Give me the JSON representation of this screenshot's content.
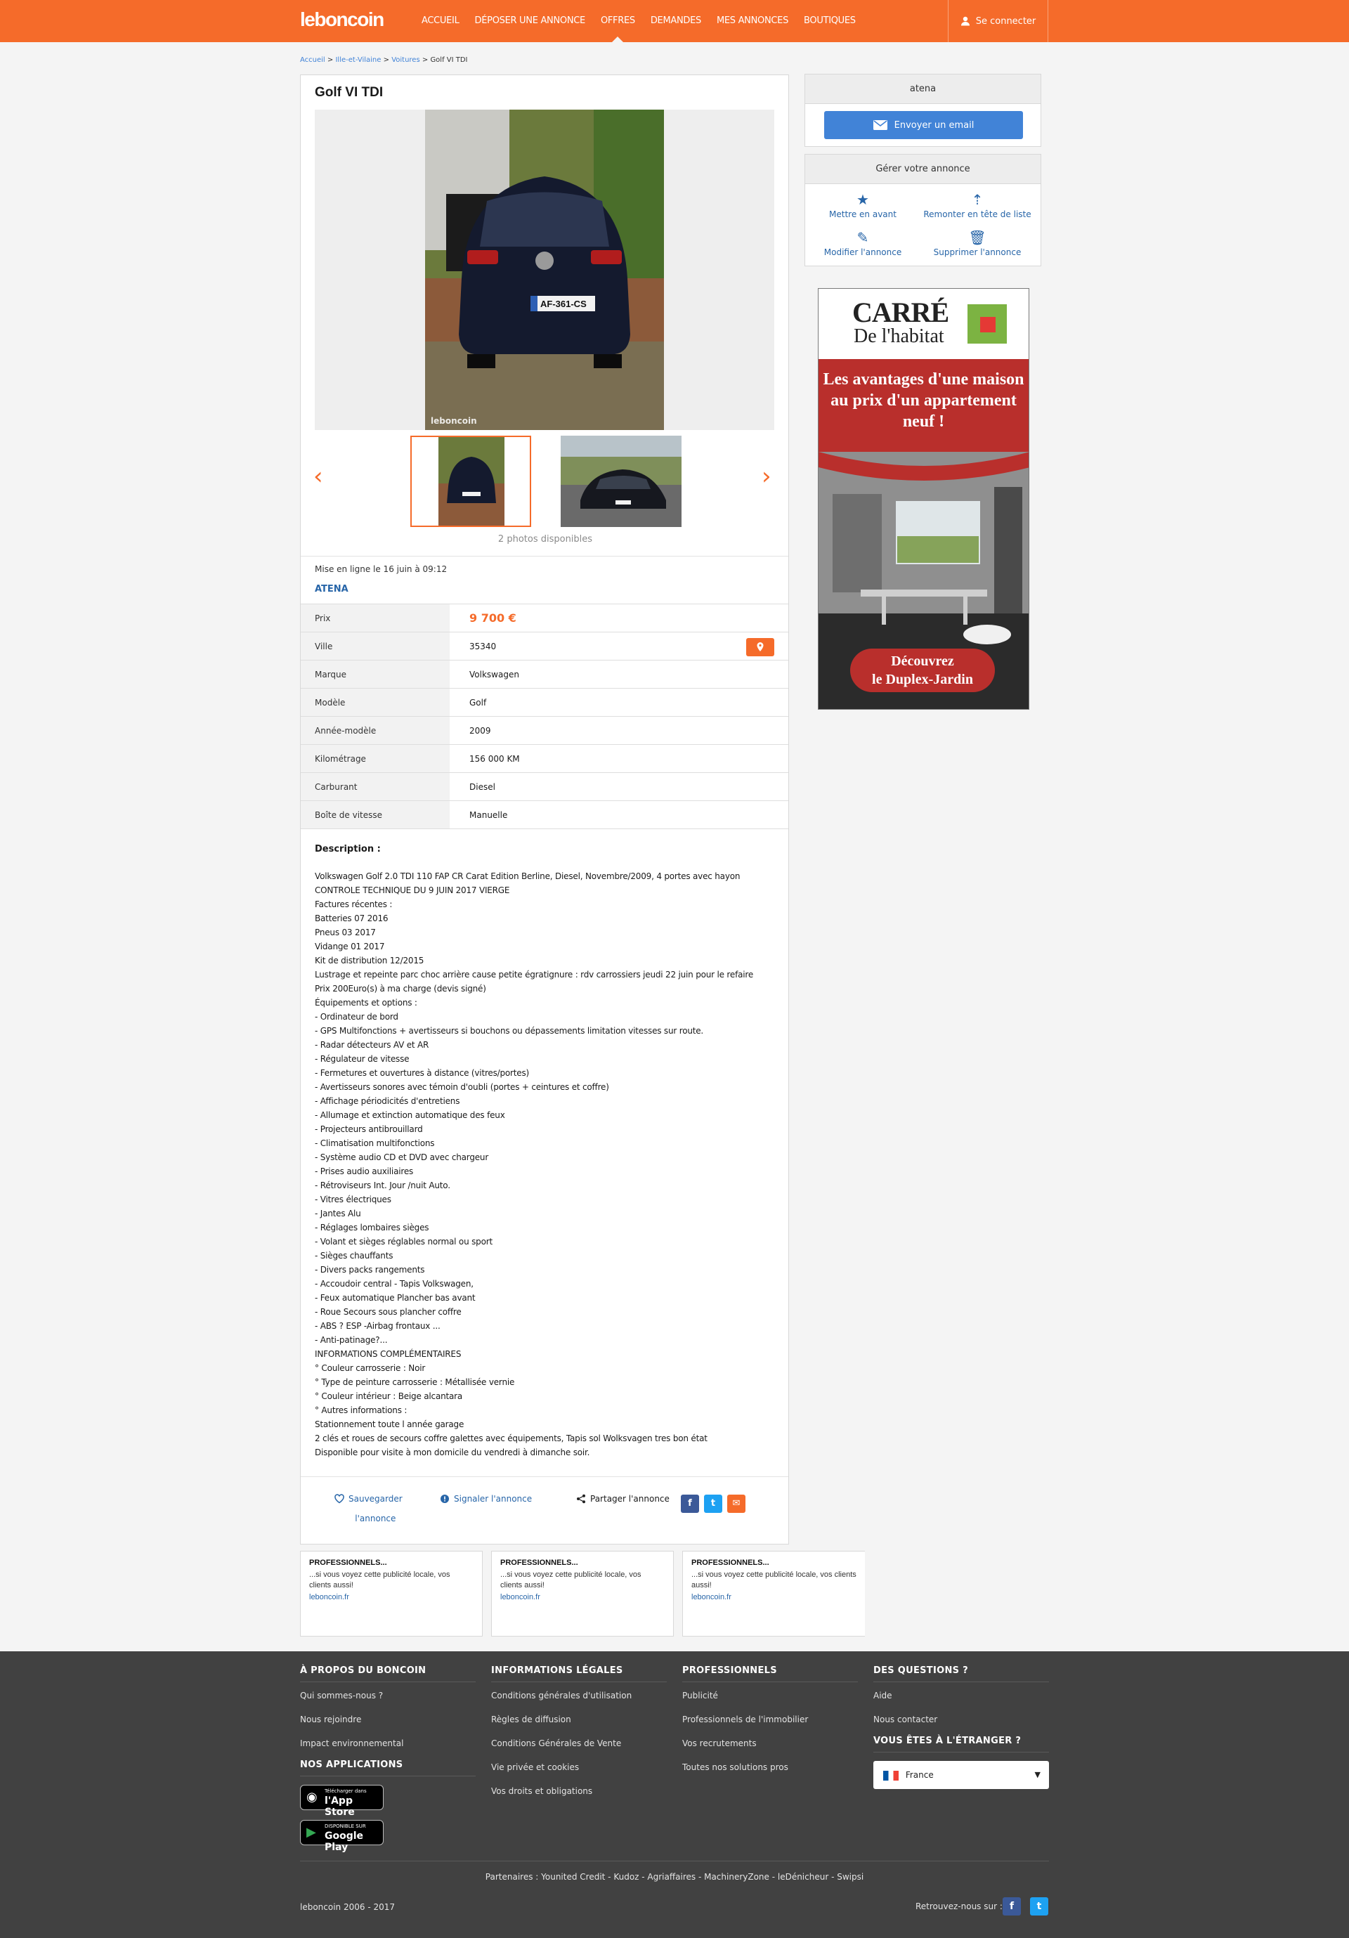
{
  "header": {
    "logo": "leboncoin",
    "nav": [
      "ACCUEIL",
      "DÉPOSER UNE ANNONCE",
      "OFFRES",
      "DEMANDES",
      "MES ANNONCES",
      "BOUTIQUES"
    ],
    "login_label": "Se connecter"
  },
  "breadcrumb": {
    "home": "Accueil",
    "region": "Ille-et-Vilaine",
    "category": "Voitures",
    "current": "Golf VI TDI",
    "separator": ">"
  },
  "ad": {
    "title": "Golf VI TDI",
    "photo_watermark": "leboncoin",
    "photo_count": "2 photos disponibles",
    "published": "Mise en ligne le 16 juin à 09:12",
    "seller": "ATENA",
    "properties": [
      {
        "key": "Prix",
        "value": "9 700 €"
      },
      {
        "key": "Ville",
        "value": "35340"
      },
      {
        "key": "Marque",
        "value": "Volkswagen"
      },
      {
        "key": "Modèle",
        "value": "Golf"
      },
      {
        "key": "Année-modèle",
        "value": "2009"
      },
      {
        "key": "Kilométrage",
        "value": "156 000 KM"
      },
      {
        "key": "Carburant",
        "value": "Diesel"
      },
      {
        "key": "Boîte de vitesse",
        "value": "Manuelle"
      }
    ],
    "description_title": "Description :",
    "description": "Volkswagen Golf 2.0 TDI 110 FAP CR Carat Edition Berline, Diesel, Novembre/2009, 4 portes avec hayon\nCONTROLE TECHNIQUE DU 9 JUIN 2017 VIERGE\nFactures récentes :\nBatteries 07 2016\nPneus 03 2017\nVidange 01 2017\nKit de distribution 12/2015\nLustrage et repeinte parc choc arrière cause petite égratignure : rdv carrossiers jeudi 22 juin pour le refaire\nPrix 200Euro(s) à ma charge (devis signé)\nÉquipements et options :\n- Ordinateur de bord\n- GPS Multifonctions + avertisseurs si bouchons ou dépassements limitation vitesses sur route.\n- Radar détecteurs AV et AR\n- Régulateur de vitesse\n- Fermetures et ouvertures à distance (vitres/portes)\n- Avertisseurs sonores avec témoin d'oubli (portes + ceintures et coffre)\n- Affichage périodicités d'entretiens\n- Allumage et extinction automatique des feux\n- Projecteurs antibrouillard\n- Climatisation multifonctions\n- Système audio CD et DVD avec chargeur\n- Prises audio auxiliaires\n- Rétroviseurs Int. Jour /nuit Auto.\n- Vitres électriques\n- Jantes Alu\n- Réglages lombaires sièges\n- Volant et sièges réglables normal ou sport\n- Sièges chauffants\n- Divers packs rangements\n- Accoudoir central - Tapis Volkswagen,\n- Feux automatique Plancher bas avant\n- Roue Secours sous plancher coffre\n- ABS ? ESP -Airbag frontaux ...\n- Anti-patinage?...\nINFORMATIONS COMPLÉMENTAIRES\n° Couleur carrosserie : Noir\n° Type de peinture carrosserie : Métallisée vernie\n° Couleur intérieur : Beige alcantara\n° Autres informations :\nStationnement toute l année garage\n2 clés et roues de secours coffre galettes avec équipements, Tapis sol Wolksvagen tres bon état\nDisponible pour visite à mon domicile du vendredi à dimanche soir.",
    "save_label_1": "Sauvegarder",
    "save_label_2": "l'annonce",
    "report_label": "Signaler l'annonce",
    "share_label": "Partager l'annonce"
  },
  "pro_banners": [
    {
      "title": "PROFESSIONNELS...",
      "text": "...si vous voyez cette publicité locale, vos clients aussi!",
      "link": "leboncoin.fr"
    },
    {
      "title": "PROFESSIONNELS...",
      "text": "...si vous voyez cette publicité locale, vos clients aussi!",
      "link": "leboncoin.fr"
    },
    {
      "title": "PROFESSIONNELS...",
      "text": "...si vous voyez cette publicité locale, vos clients aussi!",
      "link": "leboncoin.fr"
    }
  ],
  "sidebar": {
    "contact_name": "atena",
    "email_button": "Envoyer un email",
    "manage_title": "Gérer votre annonce",
    "manage_actions": [
      "Mettre en avant",
      "Remonter en tête de liste",
      "Modifier l'annonce",
      "Supprimer l'annonce"
    ]
  },
  "advert": {
    "brand_line1": "CARRÉ",
    "brand_line2": "De l'habitat",
    "headline": "Les avantages d'une maison au prix d'un appartement neuf !",
    "cta_line1": "Découvrez",
    "cta_line2": "le Duplex-Jardin"
  },
  "footer": {
    "columns": [
      {
        "title": "À PROPOS DU BONCOIN",
        "links": [
          "Qui sommes-nous ?",
          "Nous rejoindre",
          "Impact environnemental"
        ]
      },
      {
        "title": "INFORMATIONS LÉGALES",
        "links": [
          "Conditions générales d'utilisation",
          "Règles de diffusion",
          "Conditions Générales de Vente",
          "Vie privée et cookies",
          "Vos droits et obligations"
        ]
      },
      {
        "title": "PROFESSIONNELS",
        "links": [
          "Publicité",
          "Professionnels de l'immobilier",
          "Vos recrutements",
          "Toutes nos solutions pros"
        ]
      },
      {
        "title": "DES QUESTIONS ?",
        "links": [
          "Aide",
          "Nous contacter"
        ]
      }
    ],
    "apps_title": "NOS APPLICATIONS",
    "app_store_small": "Télécharger dans",
    "app_store": "l'App Store",
    "google_play_small": "DISPONIBLE SUR",
    "google_play": "Google Play",
    "abroad_title": "VOUS ÊTES À L'ÉTRANGER ?",
    "country": "France",
    "partners": "Partenaires : Younited Credit - Kudoz - Agriaffaires - MachineryZone - leDénicheur - Swipsi",
    "copyright": "leboncoin 2006 - 2017",
    "follow_us": "Retrouvez-nous sur :"
  },
  "colors": {
    "brand_orange": "#f56b2a",
    "link_blue": "#2765a8",
    "button_blue": "#4183d7",
    "footer_bg": "#414141"
  }
}
